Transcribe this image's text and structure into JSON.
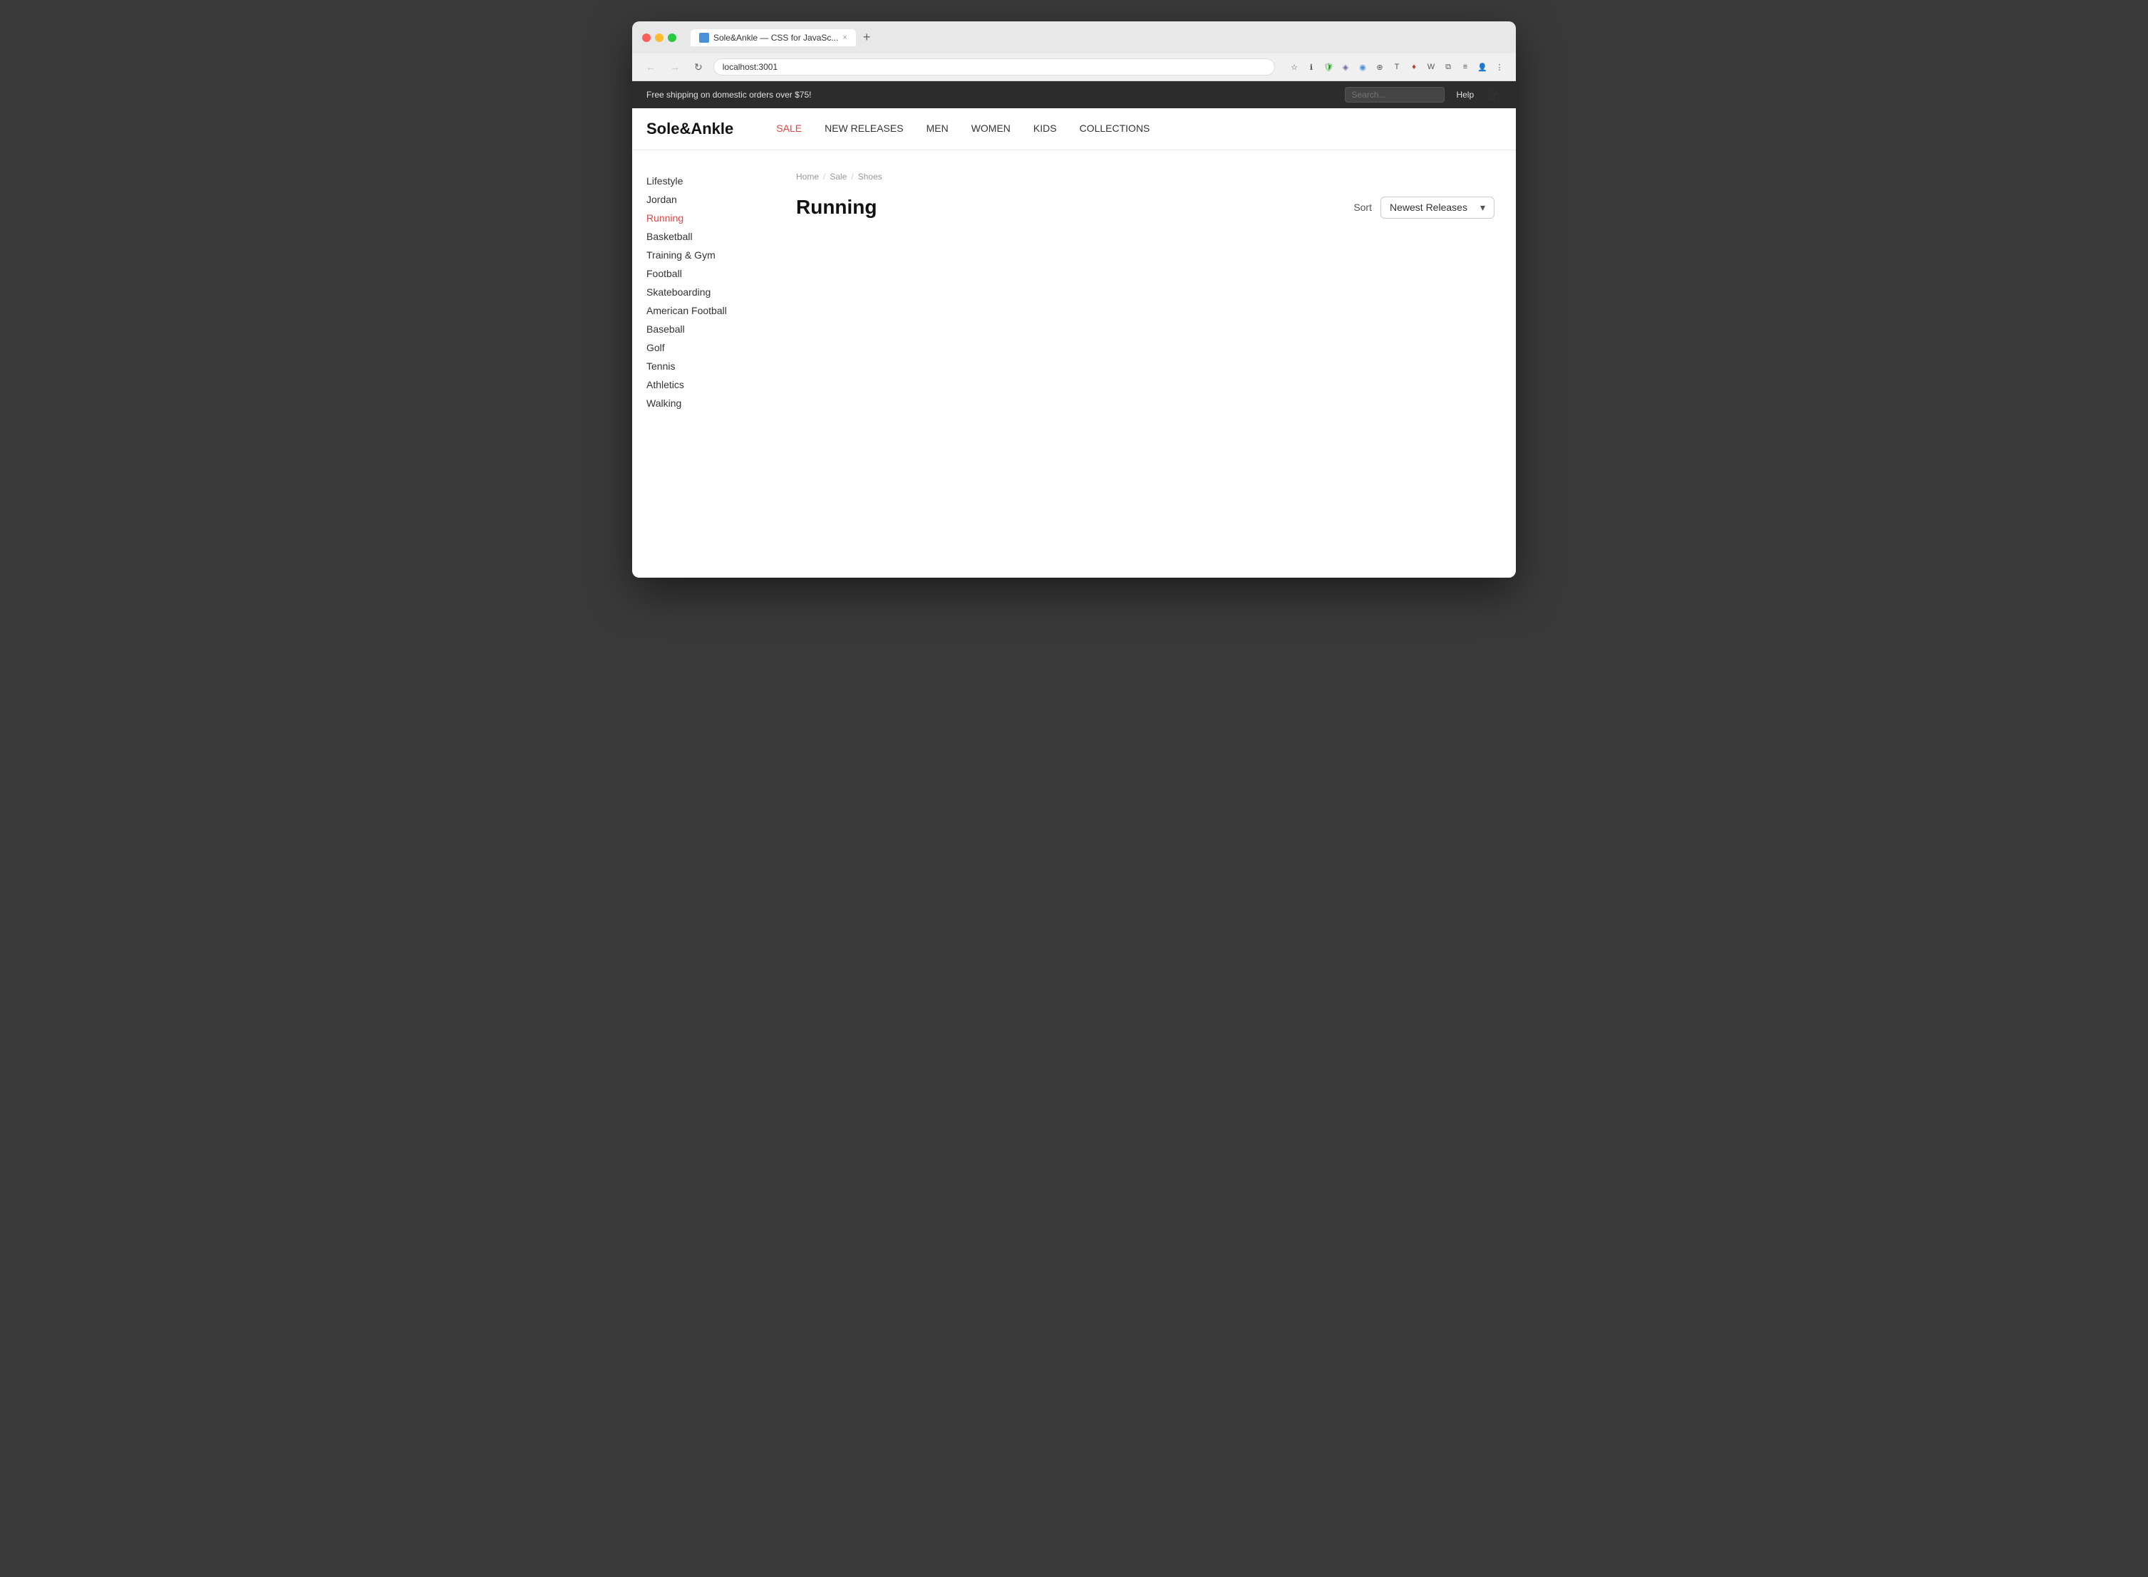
{
  "browser": {
    "tab_title": "Sole&Ankle — CSS for JavaSc...",
    "tab_close": "×",
    "new_tab": "+",
    "url": "localhost:3001",
    "nav_back": "←",
    "nav_forward": "→",
    "nav_refresh": "↻"
  },
  "banner": {
    "message": "Free shipping on domestic orders over $75!",
    "search_placeholder": "Search...",
    "help_label": "Help"
  },
  "nav": {
    "logo": "Sole&Ankle",
    "links": [
      {
        "label": "SALE",
        "active": true
      },
      {
        "label": "NEW RELEASES",
        "active": false
      },
      {
        "label": "MEN",
        "active": false
      },
      {
        "label": "WOMEN",
        "active": false
      },
      {
        "label": "KIDS",
        "active": false
      },
      {
        "label": "COLLECTIONS",
        "active": false
      }
    ]
  },
  "breadcrumb": {
    "home": "Home",
    "sale": "Sale",
    "shoes": "Shoes",
    "sep": "/"
  },
  "page": {
    "title": "Running",
    "sort_label": "Sort",
    "sort_value": "Newest Releases"
  },
  "sidebar": {
    "items": [
      {
        "label": "Lifestyle",
        "active": false
      },
      {
        "label": "Jordan",
        "active": false
      },
      {
        "label": "Running",
        "active": true
      },
      {
        "label": "Basketball",
        "active": false
      },
      {
        "label": "Training & Gym",
        "active": false
      },
      {
        "label": "Football",
        "active": false
      },
      {
        "label": "Skateboarding",
        "active": false
      },
      {
        "label": "American Football",
        "active": false
      },
      {
        "label": "Baseball",
        "active": false
      },
      {
        "label": "Golf",
        "active": false
      },
      {
        "label": "Tennis",
        "active": false
      },
      {
        "label": "Athletics",
        "active": false
      },
      {
        "label": "Walking",
        "active": false
      }
    ]
  }
}
